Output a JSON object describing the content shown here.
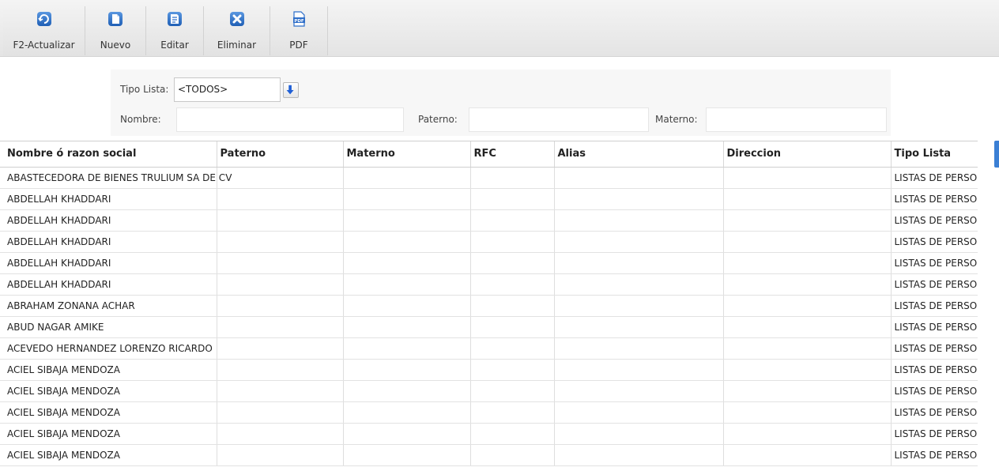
{
  "toolbar": {
    "buttons": [
      {
        "label": "F2-Actualizar",
        "icon": "refresh-icon"
      },
      {
        "label": "Nuevo",
        "icon": "new-document-icon"
      },
      {
        "label": "Editar",
        "icon": "edit-document-icon"
      },
      {
        "label": "Eliminar",
        "icon": "delete-icon"
      },
      {
        "label": "PDF",
        "icon": "pdf-icon"
      }
    ]
  },
  "filters": {
    "tipo_label": "Tipo Lista:",
    "tipo_value": "<TODOS>",
    "tipo_button_icon": "arrow-down-icon",
    "nombre_label": "Nombre:",
    "nombre_value": "",
    "paterno_label": "Paterno:",
    "paterno_value": "",
    "materno_label": "Materno:",
    "materno_value": ""
  },
  "table": {
    "columns": [
      "Nombre ó razon social",
      "Paterno",
      "Materno",
      "RFC",
      "Alias",
      "Direccion",
      "Tipo Lista"
    ],
    "rows": [
      [
        "ABASTECEDORA DE BIENES TRULIUM SA DE CV",
        "",
        "",
        "",
        "",
        "",
        "LISTAS DE PERSONAS"
      ],
      [
        "ABDELLAH KHADDARI",
        "",
        "",
        "",
        "",
        "",
        "LISTAS DE PERSONAS"
      ],
      [
        "ABDELLAH KHADDARI",
        "",
        "",
        "",
        "",
        "",
        "LISTAS DE PERSONAS"
      ],
      [
        "ABDELLAH KHADDARI",
        "",
        "",
        "",
        "",
        "",
        "LISTAS DE PERSONAS"
      ],
      [
        "ABDELLAH KHADDARI",
        "",
        "",
        "",
        "",
        "",
        "LISTAS DE PERSONAS"
      ],
      [
        "ABDELLAH KHADDARI",
        "",
        "",
        "",
        "",
        "",
        "LISTAS DE PERSONAS"
      ],
      [
        "ABRAHAM ZONANA ACHAR",
        "",
        "",
        "",
        "",
        "",
        "LISTAS DE PERSONAS"
      ],
      [
        "ABUD NAGAR AMIKE",
        "",
        "",
        "",
        "",
        "",
        "LISTAS DE PERSONAS"
      ],
      [
        "ACEVEDO HERNANDEZ LORENZO RICARDO",
        "",
        "",
        "",
        "",
        "",
        "LISTAS DE PERSONAS"
      ],
      [
        "ACIEL SIBAJA MENDOZA",
        "",
        "",
        "",
        "",
        "",
        "LISTAS DE PERSONAS"
      ],
      [
        "ACIEL SIBAJA MENDOZA",
        "",
        "",
        "",
        "",
        "",
        "LISTAS DE PERSONAS"
      ],
      [
        "ACIEL SIBAJA MENDOZA",
        "",
        "",
        "",
        "",
        "",
        "LISTAS DE PERSONAS"
      ],
      [
        "ACIEL SIBAJA MENDOZA",
        "",
        "",
        "",
        "",
        "",
        "LISTAS DE PERSONAS"
      ],
      [
        "ACIEL SIBAJA MENDOZA",
        "",
        "",
        "",
        "",
        "",
        "LISTAS DE PERSONAS"
      ]
    ]
  },
  "colors": {
    "icon_blue": "#2f6fc9",
    "scroll_accent": "#3b7fd4"
  }
}
